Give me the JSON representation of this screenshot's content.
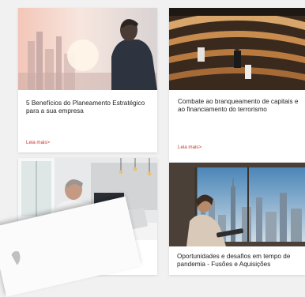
{
  "articles": [
    {
      "title": "5 Benefícios do Planeamento Estratégico para a sua empresa",
      "link": "Leia mais>"
    },
    {
      "title": "Combate ao branqueamento de capitais e ao financiamento do terrorismo",
      "link": "Leia mais>"
    },
    {
      "title": "",
      "link": ""
    },
    {
      "title": "Oportunidades e desafios em tempo de pandemia - Fusões e Aquisições",
      "link": ""
    }
  ],
  "colors": {
    "link": "#c0392b",
    "background": "#f1f1f1",
    "card": "#ffffff"
  }
}
